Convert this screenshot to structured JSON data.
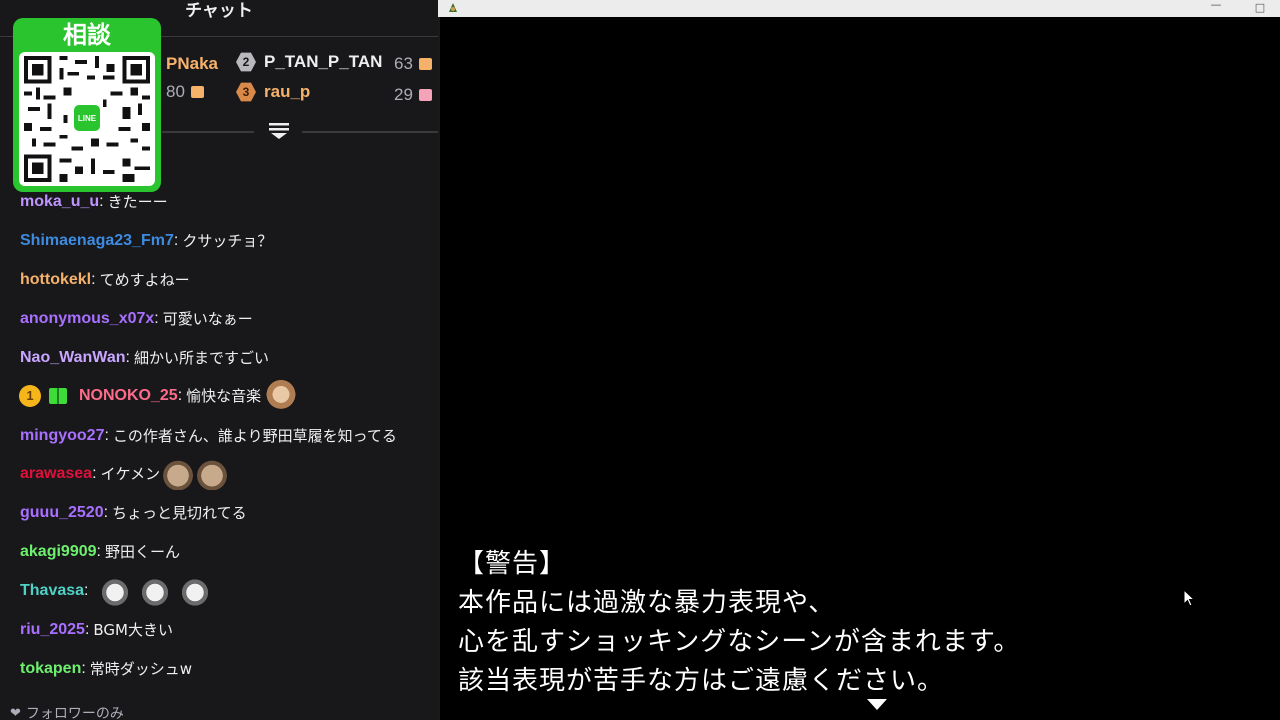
{
  "chat": {
    "title": "チャット",
    "leaderboard": {
      "top1_name_partial": "PNaka",
      "top1_count_partial": "80",
      "rank2": {
        "rank": "2",
        "name": "P_TAN_P_TAN",
        "count": "63"
      },
      "rank3": {
        "rank": "3",
        "name": "rau_p",
        "count": "29"
      }
    },
    "overlay": {
      "title": "相談",
      "logo_text": "LINE"
    },
    "messages": [
      {
        "user": "moka_u_u",
        "color": "#bf94ff",
        "text": "きたーー"
      },
      {
        "user": "Shimaenaga23_Fm7",
        "color": "#3d8be0",
        "text": "クサッチョ？"
      },
      {
        "user": "hottokekl",
        "color": "#f6b26b",
        "text": "てめすよねー"
      },
      {
        "user": "anonymous_x07x",
        "color": "#a970ff",
        "text": "可愛いなぁー"
      },
      {
        "user": "Nao_WanWan",
        "color": "#c9a6ff",
        "text": "細かい所まですごい"
      },
      {
        "user": "NONOKO_25",
        "color": "#ff6b8a",
        "text": "愉快な音楽",
        "badge": "1",
        "emote": "bear-emote"
      },
      {
        "user": "mingyoo27",
        "color": "#a970ff",
        "text": "この作者さん、誰より野田草履を知ってる"
      },
      {
        "user": "arawasea",
        "color": "#e0103a",
        "text": "イケメン",
        "emote": "cat-emote"
      },
      {
        "user": "guuu_2520",
        "color": "#a970ff",
        "text": "ちょっと見切れてる"
      },
      {
        "user": "akagi9909",
        "color": "#6df06d",
        "text": "野田くーん"
      },
      {
        "user": "Thavasa",
        "color": "#4fd1c5",
        "text": "",
        "emote": "penguin-emote"
      },
      {
        "user": "riu_2025",
        "color": "#a970ff",
        "text": "BGM大きい"
      },
      {
        "user": "tokapen",
        "color": "#6df06d",
        "text": "常時ダッシュw"
      }
    ],
    "footer": "フォロワーのみ"
  },
  "game": {
    "warning_lines": [
      "【警告】",
      "本作品には過激な暴力表現や、",
      "心を乱すショッキングなシーンが含まれます。",
      "該当表現が苦手な方はご遠慮ください。"
    ],
    "window_controls": {
      "minimize": "—",
      "maximize": "□"
    }
  },
  "colors": {
    "chat_bg": "#18181b",
    "qr_green": "#2ac42e",
    "game_bg": "#000000"
  }
}
